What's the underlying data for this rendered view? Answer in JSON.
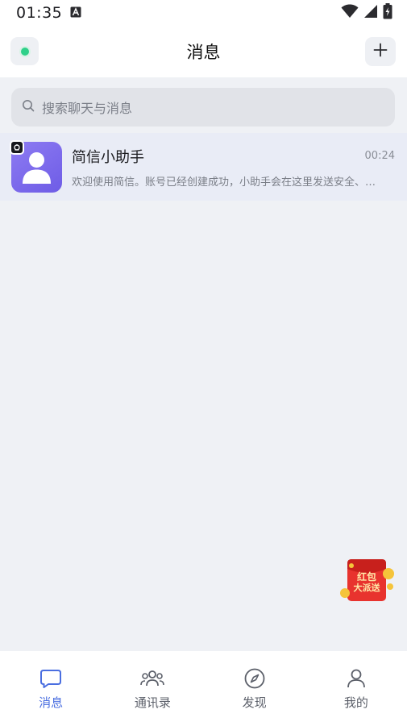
{
  "status_bar": {
    "time": "01:35",
    "icons": [
      "app-a-icon",
      "wifi-icon",
      "signal-icon",
      "battery-icon"
    ]
  },
  "header": {
    "title": "消息",
    "online_status_color": "#2fd08a",
    "add_icon": "plus-icon"
  },
  "search": {
    "placeholder": "搜索聊天与消息",
    "icon": "search-icon"
  },
  "conversations": [
    {
      "name": "简信小助手",
      "time": "00:24",
      "preview": "欢迎使用简信。账号已经创建成功，小助手会在这里发送安全、…",
      "avatar_icon": "user-icon",
      "badge_icon": "bot-icon"
    }
  ],
  "promo": {
    "line1": "红包",
    "line2": "大派送"
  },
  "tabs": [
    {
      "label": "消息",
      "icon": "chat-icon",
      "active": true
    },
    {
      "label": "通讯录",
      "icon": "contacts-icon",
      "active": false
    },
    {
      "label": "发现",
      "icon": "compass-icon",
      "active": false
    },
    {
      "label": "我的",
      "icon": "profile-icon",
      "active": false
    }
  ],
  "colors": {
    "accent": "#4a6ee0",
    "background": "#eff1f5",
    "avatar": "#7a68ea",
    "promo_red": "#e8332e",
    "promo_gold": "#f5c43a"
  }
}
